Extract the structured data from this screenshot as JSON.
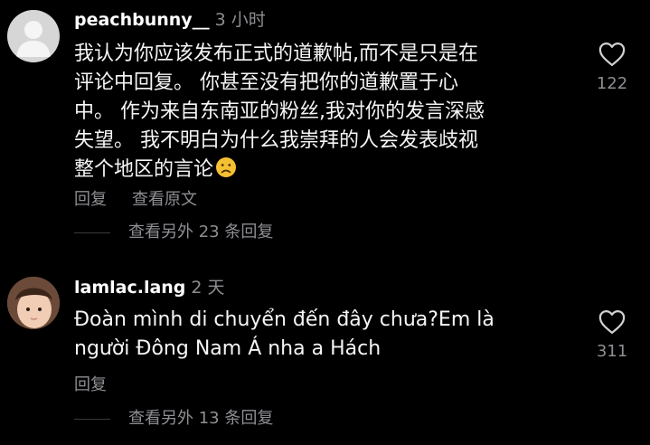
{
  "comments": [
    {
      "username": "peachbunny__",
      "time": "3 小时",
      "lines": [
        "我认为你应该发布正式的道歉帖,而不是只是在",
        "评论中回复。 你甚至没有把你的道歉置于心",
        "中。 作为来自东南亚的粉丝,我对你的发言深感",
        "失望。 我不明白为什么我崇拜的人会发表歧视",
        "整个地区的言论"
      ],
      "emoji": "sad-face",
      "actions": [
        "回复",
        "查看原文"
      ],
      "view_more": "查看另外 23 条回复",
      "likes": "122"
    },
    {
      "username": "lamlac.lang",
      "time": "2 天",
      "lines": [
        "Đoàn mình di chuyển đến đây chưa?Em là",
        "người Đông Nam Á nha a Hách"
      ],
      "actions": [
        "回复"
      ],
      "view_more": "查看另外 13 条回复",
      "likes": "311"
    }
  ],
  "colors": {
    "background": "#000000",
    "text": "#f5f5f5",
    "secondary": "#8e8e93",
    "emoji": "#f5c033"
  },
  "icons": {
    "like": "heart-outline-icon",
    "default_avatar": "person-silhouette-icon"
  }
}
